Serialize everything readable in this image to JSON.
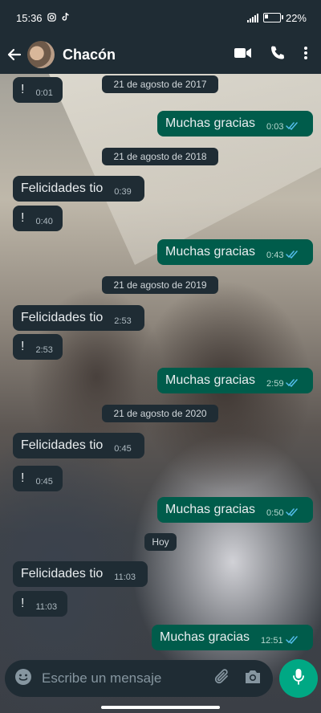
{
  "status_bar": {
    "time": "15:36",
    "battery_text": "22%",
    "battery_level": 0.22
  },
  "header": {
    "contact_name": "Chacón"
  },
  "messages": [
    {
      "type": "in",
      "text": "!",
      "time": "0:01"
    },
    {
      "type": "date",
      "text": "21 de agosto de 2017"
    },
    {
      "type": "out",
      "text": "Muchas gracias",
      "time": "0:03"
    },
    {
      "type": "date",
      "text": "21 de agosto de 2018"
    },
    {
      "type": "in",
      "text": "Felicidades tio",
      "time": "0:39"
    },
    {
      "type": "in",
      "text": "!",
      "time": "0:40"
    },
    {
      "type": "out",
      "text": "Muchas gracias",
      "time": "0:43"
    },
    {
      "type": "date",
      "text": "21 de agosto de 2019"
    },
    {
      "type": "in",
      "text": "Felicidades tio",
      "time": "2:53"
    },
    {
      "type": "in",
      "text": "!",
      "time": "2:53"
    },
    {
      "type": "out",
      "text": "Muchas gracias",
      "time": "2:59"
    },
    {
      "type": "date",
      "text": "21 de agosto de 2020"
    },
    {
      "type": "in",
      "text": "Felicidades tio",
      "time": "0:45"
    },
    {
      "type": "in",
      "text": "!",
      "time": "0:45"
    },
    {
      "type": "out",
      "text": "Muchas gracias",
      "time": "0:50"
    },
    {
      "type": "date",
      "text": "Hoy"
    },
    {
      "type": "in",
      "text": "Felicidades tio",
      "time": "11:03"
    },
    {
      "type": "in",
      "text": "!",
      "time": "11:03"
    },
    {
      "type": "out",
      "text": "Muchas gracias",
      "time": "12:51"
    }
  ],
  "input": {
    "placeholder": "Escribe un mensaje"
  },
  "colors": {
    "header_bg": "#1f2c34",
    "incoming_bubble": "#1f2c34",
    "outgoing_bubble": "#005c4b",
    "mic_button": "#00a884",
    "read_ticks": "#53bdeb"
  },
  "icons": [
    "instagram-icon",
    "tiktok-icon",
    "signal-icon",
    "battery-icon",
    "back-arrow-icon",
    "video-call-icon",
    "phone-icon",
    "more-options-icon",
    "double-check-icon",
    "emoji-icon",
    "attach-icon",
    "camera-icon",
    "mic-icon"
  ]
}
